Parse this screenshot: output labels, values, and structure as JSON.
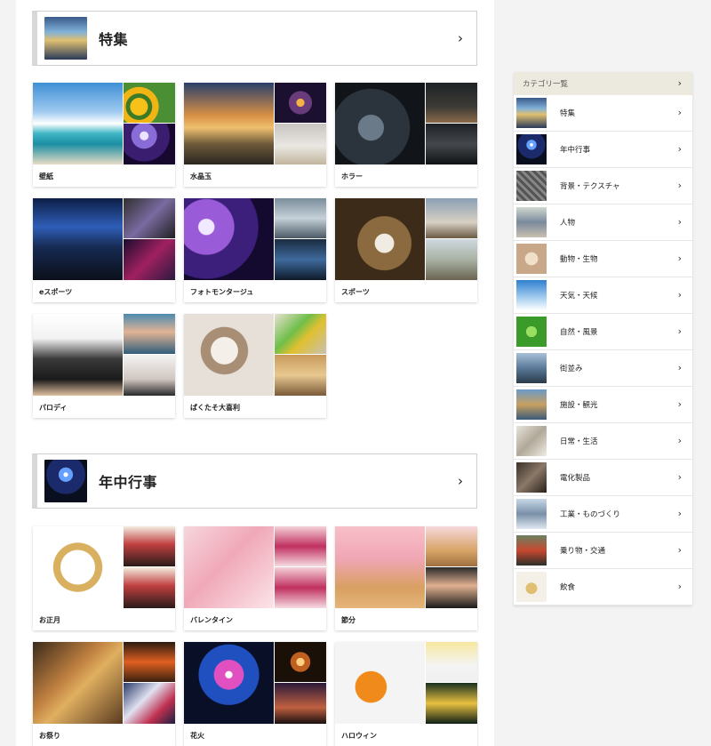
{
  "sections": [
    {
      "header": {
        "title": "特集",
        "thumb_icon": "featured-thumb"
      },
      "cards": [
        {
          "label": "壁紙"
        },
        {
          "label": "水晶玉"
        },
        {
          "label": "ホラー"
        },
        {
          "label": "eスポーツ"
        },
        {
          "label": "フォトモンタージュ"
        },
        {
          "label": "スポーツ"
        },
        {
          "label": "パロディ"
        },
        {
          "label": "ぱくたそ大喜利"
        }
      ]
    },
    {
      "header": {
        "title": "年中行事",
        "thumb_icon": "fireworks-thumb"
      },
      "cards": [
        {
          "label": "お正月"
        },
        {
          "label": "バレンタイン"
        },
        {
          "label": "節分"
        },
        {
          "label": "お祭り"
        },
        {
          "label": "花火"
        },
        {
          "label": "ハロウィン"
        }
      ]
    }
  ],
  "sidebar": {
    "header": "カテゴリ一覧",
    "items": [
      {
        "label": "特集"
      },
      {
        "label": "年中行事"
      },
      {
        "label": "背景・テクスチャ"
      },
      {
        "label": "人物"
      },
      {
        "label": "動物・生物"
      },
      {
        "label": "天気・天候"
      },
      {
        "label": "自然・風景"
      },
      {
        "label": "街並み"
      },
      {
        "label": "施設・観光"
      },
      {
        "label": "日常・生活"
      },
      {
        "label": "電化製品"
      },
      {
        "label": "工業・ものづくり"
      },
      {
        "label": "乗り物・交通"
      },
      {
        "label": "飲食"
      }
    ]
  },
  "icons": {
    "chevron": "chevron-right-icon"
  }
}
